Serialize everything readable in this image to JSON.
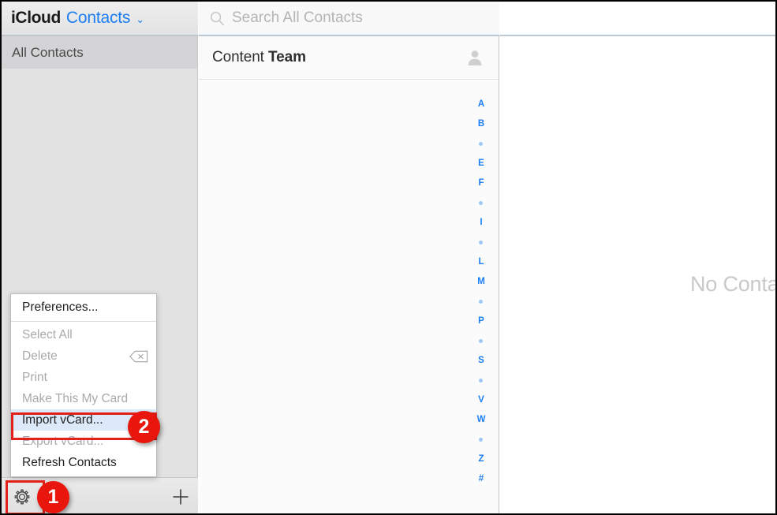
{
  "window": {
    "title": "iCloud Contacts"
  },
  "topbar": {
    "brand_primary": "iCloud",
    "brand_app": "Contacts",
    "brand_caret": "⌄",
    "search_icon": "search-icon",
    "search_value": "",
    "search_placeholder": "Search All Contacts"
  },
  "sidebar": {
    "items": [
      {
        "label": "All Contacts",
        "selected": true
      }
    ],
    "toolbar": {
      "settings_icon": "gear-icon",
      "add_icon": "plus-icon"
    }
  },
  "list": {
    "header": {
      "first_name": "Content",
      "last_name": "Team",
      "avatar_icon": "person-icon"
    },
    "index": [
      {
        "type": "letter",
        "label": "A"
      },
      {
        "type": "letter",
        "label": "B"
      },
      {
        "type": "dot",
        "label": "•"
      },
      {
        "type": "letter",
        "label": "E"
      },
      {
        "type": "letter",
        "label": "F"
      },
      {
        "type": "dot",
        "label": "•"
      },
      {
        "type": "letter",
        "label": "I"
      },
      {
        "type": "dot",
        "label": "•"
      },
      {
        "type": "letter",
        "label": "L"
      },
      {
        "type": "letter",
        "label": "M"
      },
      {
        "type": "dot",
        "label": "•"
      },
      {
        "type": "letter",
        "label": "P"
      },
      {
        "type": "dot",
        "label": "•"
      },
      {
        "type": "letter",
        "label": "S"
      },
      {
        "type": "dot",
        "label": "•"
      },
      {
        "type": "letter",
        "label": "V"
      },
      {
        "type": "letter",
        "label": "W"
      },
      {
        "type": "dot",
        "label": "•"
      },
      {
        "type": "letter",
        "label": "Z"
      },
      {
        "type": "letter",
        "label": "#"
      }
    ]
  },
  "detail": {
    "empty_message": "No Contact Selected"
  },
  "menu": {
    "items": [
      {
        "label": "Preferences...",
        "disabled": false,
        "highlighted": false,
        "shortcut": ""
      },
      {
        "label": "Select All",
        "disabled": true,
        "highlighted": false,
        "shortcut": ""
      },
      {
        "label": "Delete",
        "disabled": true,
        "highlighted": false,
        "shortcut": "⌫"
      },
      {
        "label": "Print",
        "disabled": true,
        "highlighted": false,
        "shortcut": ""
      },
      {
        "label": "Make This My Card",
        "disabled": true,
        "highlighted": false,
        "shortcut": ""
      },
      {
        "label": "Import vCard...",
        "disabled": false,
        "highlighted": true,
        "shortcut": ""
      },
      {
        "label": "Export vCard...",
        "disabled": true,
        "highlighted": false,
        "shortcut": ""
      },
      {
        "label": "Refresh Contacts",
        "disabled": false,
        "highlighted": false,
        "shortcut": ""
      }
    ]
  },
  "annotations": {
    "step_one": "1",
    "step_two": "2",
    "highlight_color": "#e32119",
    "badge_color": "#e8160c"
  }
}
